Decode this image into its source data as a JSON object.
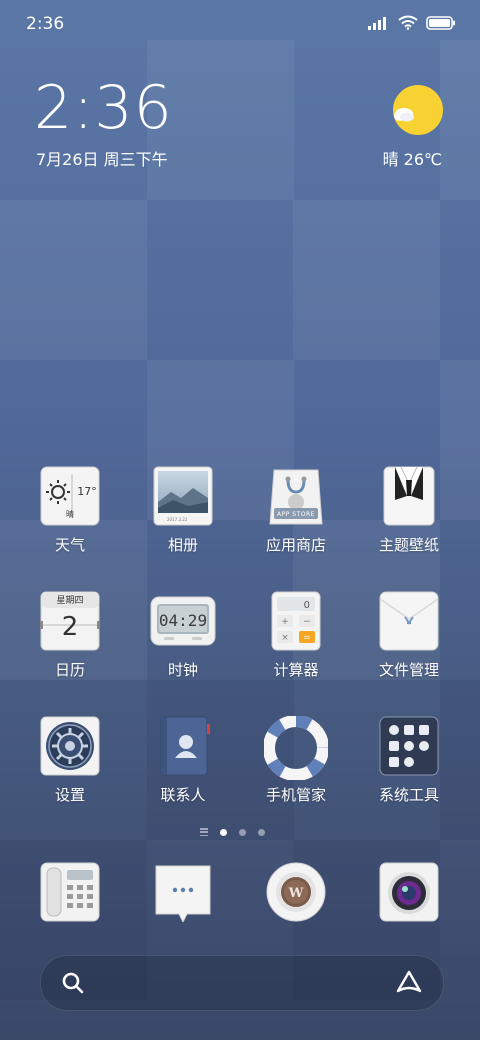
{
  "status_bar": {
    "time": "2:36",
    "icons": [
      "signal-icon",
      "wifi-icon",
      "battery-icon"
    ]
  },
  "clock_widget": {
    "time": "2:36",
    "date": "7月26日 周三下午"
  },
  "weather_widget": {
    "condition": "晴",
    "temperature": "26℃",
    "icon": "sun-cloud-icon"
  },
  "apps": [
    {
      "label": "天气",
      "icon": "weather-icon",
      "temp": "17°",
      "cond": "晴"
    },
    {
      "label": "相册",
      "icon": "gallery-icon",
      "caption": "2017.3.22"
    },
    {
      "label": "应用商店",
      "icon": "app-store-icon",
      "caption": "APP STORE"
    },
    {
      "label": "主题壁纸",
      "icon": "themes-icon"
    },
    {
      "label": "日历",
      "icon": "calendar-icon",
      "weekday": "星期四",
      "day": "2"
    },
    {
      "label": "时钟",
      "icon": "clock-icon",
      "display": "04:29"
    },
    {
      "label": "计算器",
      "icon": "calculator-icon",
      "display": "0"
    },
    {
      "label": "文件管理",
      "icon": "file-manager-icon"
    },
    {
      "label": "设置",
      "icon": "settings-icon"
    },
    {
      "label": "联系人",
      "icon": "contacts-icon"
    },
    {
      "label": "手机管家",
      "icon": "security-lifebuoy-icon"
    },
    {
      "label": "系统工具",
      "icon": "system-tools-icon"
    }
  ],
  "page_indicator": {
    "pages": 3,
    "active": 1
  },
  "dock": [
    {
      "icon": "phone-icon"
    },
    {
      "icon": "messages-icon"
    },
    {
      "icon": "browser-icon"
    },
    {
      "icon": "camera-icon"
    }
  ],
  "search_bar": {
    "left_icon": "search-icon",
    "right_icon": "assistant-icon"
  }
}
